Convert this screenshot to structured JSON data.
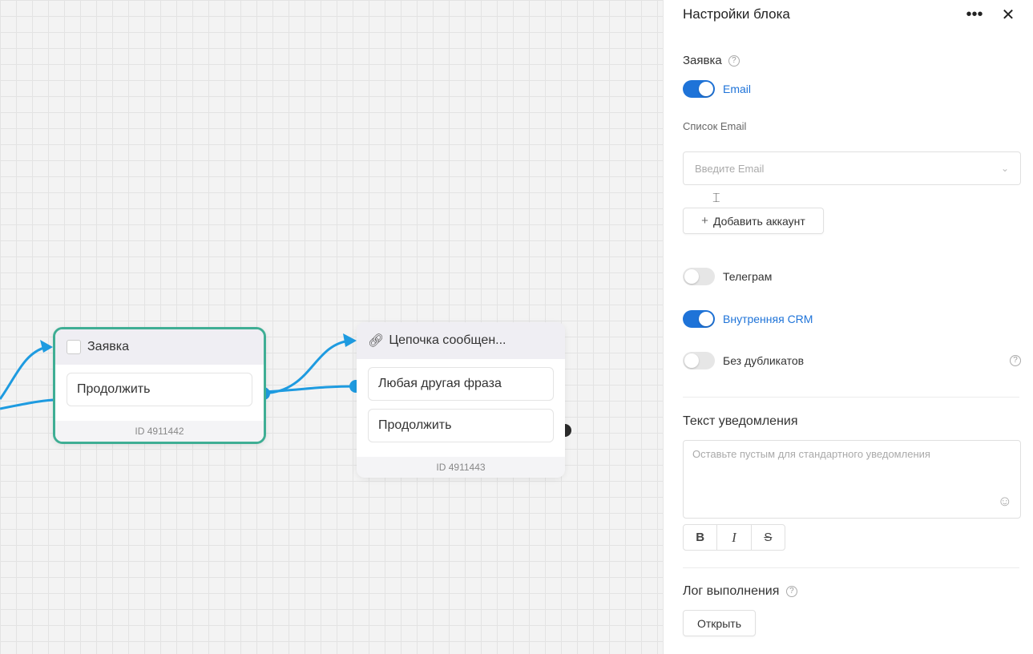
{
  "canvas": {
    "nodes": {
      "zayavka": {
        "title": "Заявка",
        "button": "Продолжить",
        "id_label": "ID 4911442"
      },
      "chain": {
        "title": "Цепочка сообщен...",
        "buttons": [
          "Любая другая фраза",
          "Продолжить"
        ],
        "id_label": "ID 4911443"
      }
    },
    "colors": {
      "wire": "#1e9be0",
      "selected_border": "#3fae94"
    }
  },
  "panel": {
    "title": "Настройки блока",
    "more_icon": "more-dots-icon",
    "close_icon": "close-icon",
    "request_section": {
      "label": "Заявка",
      "help_glyph": "?"
    },
    "toggles": {
      "email": {
        "label": "Email",
        "on": true
      },
      "telegram": {
        "label": "Телеграм",
        "on": false
      },
      "crm": {
        "label": "Внутренняя CRM",
        "on": true
      },
      "no_duplicates": {
        "label": "Без дубликатов",
        "on": false
      }
    },
    "email_list": {
      "caption": "Список Email",
      "placeholder": "Введите Email",
      "chevron": "⌄"
    },
    "add_account": {
      "plus": "+",
      "label": "Добавить аккаунт"
    },
    "notification": {
      "heading": "Текст уведомления",
      "placeholder": "Оставьте пустым для стандартного уведомления",
      "format": {
        "bold": "B",
        "italic": "I",
        "strike": "S"
      }
    },
    "log": {
      "heading": "Лог выполнения",
      "help_glyph": "?",
      "open_button": "Открыть"
    },
    "accent": "#1e73d8"
  }
}
